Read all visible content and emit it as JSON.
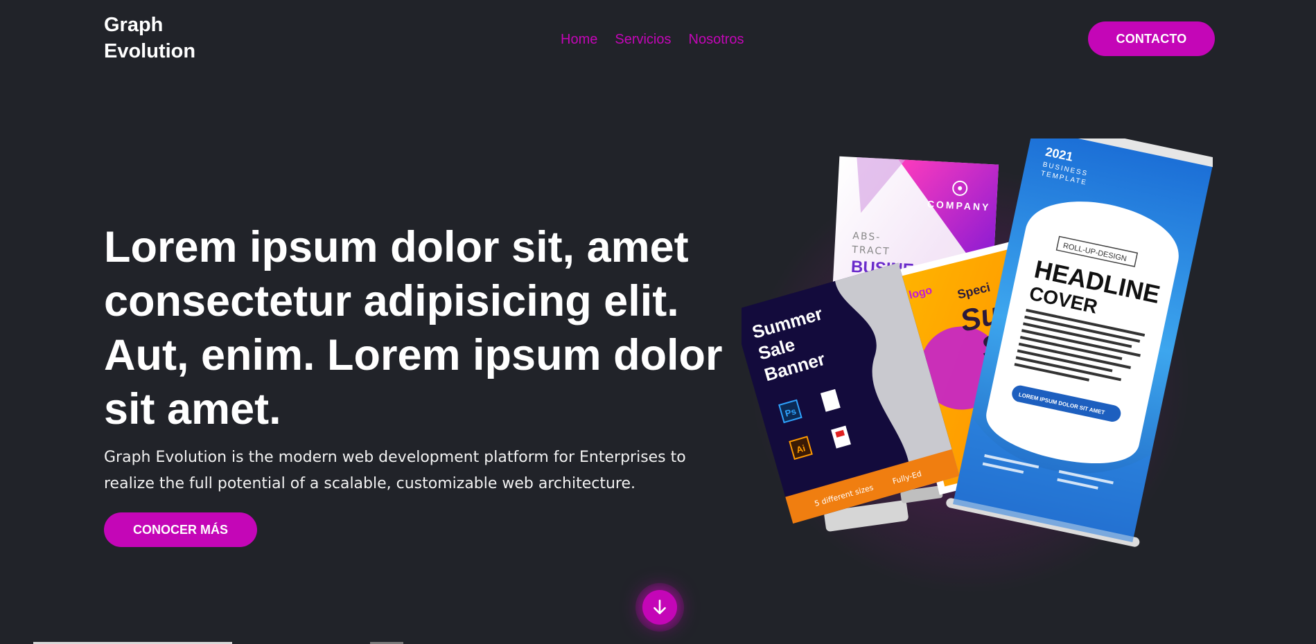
{
  "header": {
    "brand_line1": "Graph",
    "brand_line2": "Evolution",
    "nav": [
      {
        "label": "Home"
      },
      {
        "label": "Servicios"
      },
      {
        "label": "Nosotros"
      }
    ],
    "contact_label": "CONTACTO"
  },
  "hero": {
    "headline": "Lorem ipsum dolor sit, amet consectetur adipisicing elit. Aut, enim. Lorem ipsum dolor sit amet.",
    "subtext": "Graph Evolution is the modern web development platform for Enterprises to realize the full potential of a scalable, customizable web architecture.",
    "cta_label": "CONOCER MÁS"
  },
  "graphic": {
    "back_banner": {
      "brand": "COMPANY",
      "line1": "ABS-",
      "line2": "TRACT",
      "line3": "BUSINE"
    },
    "left_banner": {
      "title_line1": "Summer",
      "title_line2": "Sale",
      "title_line3": "Banner",
      "footer": "5 different sizes",
      "footer2": "Fully-Ed",
      "icon_ps": "Ps",
      "icon_ai": "Ai"
    },
    "middle_banner": {
      "logo": "logo",
      "word": "Speci",
      "big1": "Su",
      "big2": "S"
    },
    "front_banner": {
      "year": "2021",
      "sub1": "BUSINESS",
      "sub2": "TEMPLATE",
      "tag": "ROLL-UP-DESIGN",
      "headline1": "HEADLINE",
      "headline2": "COVER",
      "button": "LOREM IPSUM DOLOR SIT AMET"
    }
  },
  "colors": {
    "background": "#212329",
    "accent": "#c406b7",
    "text": "#ffffff"
  },
  "icons": {
    "scroll": "arrow-down-icon"
  }
}
